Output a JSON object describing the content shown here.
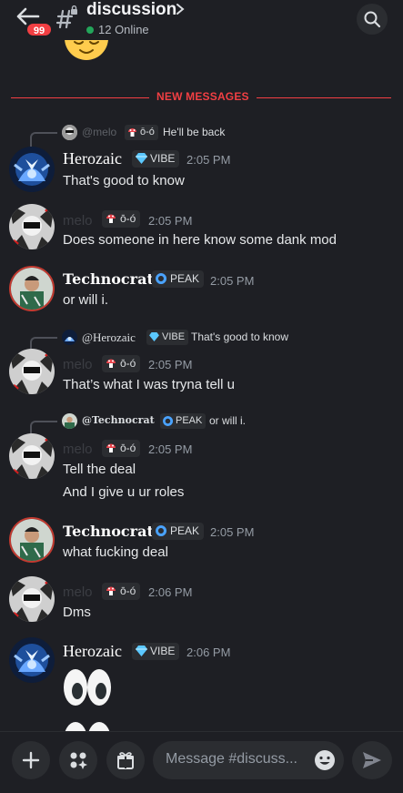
{
  "header": {
    "channel_name": "discussion",
    "online_text": "12 Online",
    "unread_badge": "99"
  },
  "divider_label": "NEW MESSAGES",
  "messages": [
    {
      "reply": {
        "name": "@melo",
        "tag": "ō-ó",
        "text": "He'll be back"
      },
      "author": "Herozaic",
      "tag": "VIBE",
      "time": "2:05 PM",
      "lines": [
        "That's good to know"
      ]
    },
    {
      "author": "melo",
      "tag": "ō-ó",
      "time": "2:05 PM",
      "lines": [
        "Does someone in here know some dank mod"
      ]
    },
    {
      "author": "Technocrat",
      "tag": "PEAK",
      "time": "2:05 PM",
      "lines": [
        "or will i."
      ]
    },
    {
      "reply": {
        "name": "@Herozaic",
        "tag": "VIBE",
        "text": "That's good to know"
      },
      "author": "melo",
      "tag": "ō-ó",
      "time": "2:05 PM",
      "lines": [
        "That’s what I was tryna tell u"
      ]
    },
    {
      "reply": {
        "name": "@Technocrat",
        "tag": "PEAK",
        "text": "or will i."
      },
      "author": "melo",
      "tag": "ō-ó",
      "time": "2:05 PM",
      "lines": [
        "Tell the deal",
        "And I give u ur roles"
      ]
    },
    {
      "author": "Technocrat",
      "tag": "PEAK",
      "time": "2:05 PM",
      "lines": [
        "what fucking deal"
      ]
    },
    {
      "author": "melo",
      "tag": "ō-ó",
      "time": "2:06 PM",
      "lines": [
        "Dms"
      ]
    },
    {
      "author": "Herozaic",
      "tag": "VIBE",
      "time": "2:06 PM",
      "lines": []
    }
  ],
  "composer": {
    "placeholder": "Message #discuss..."
  },
  "icons": {
    "back": "back-arrow-icon",
    "channel": "locked-hash-icon",
    "search": "search-icon",
    "add": "plus-icon",
    "apps": "apps-icon",
    "gift": "gift-icon",
    "emoji": "smiley-icon",
    "send": "send-icon"
  },
  "colors": {
    "background": "#1e1f24",
    "accent_red": "#f23f43",
    "online_green": "#23a55a",
    "timestamp": "#949ba4"
  }
}
